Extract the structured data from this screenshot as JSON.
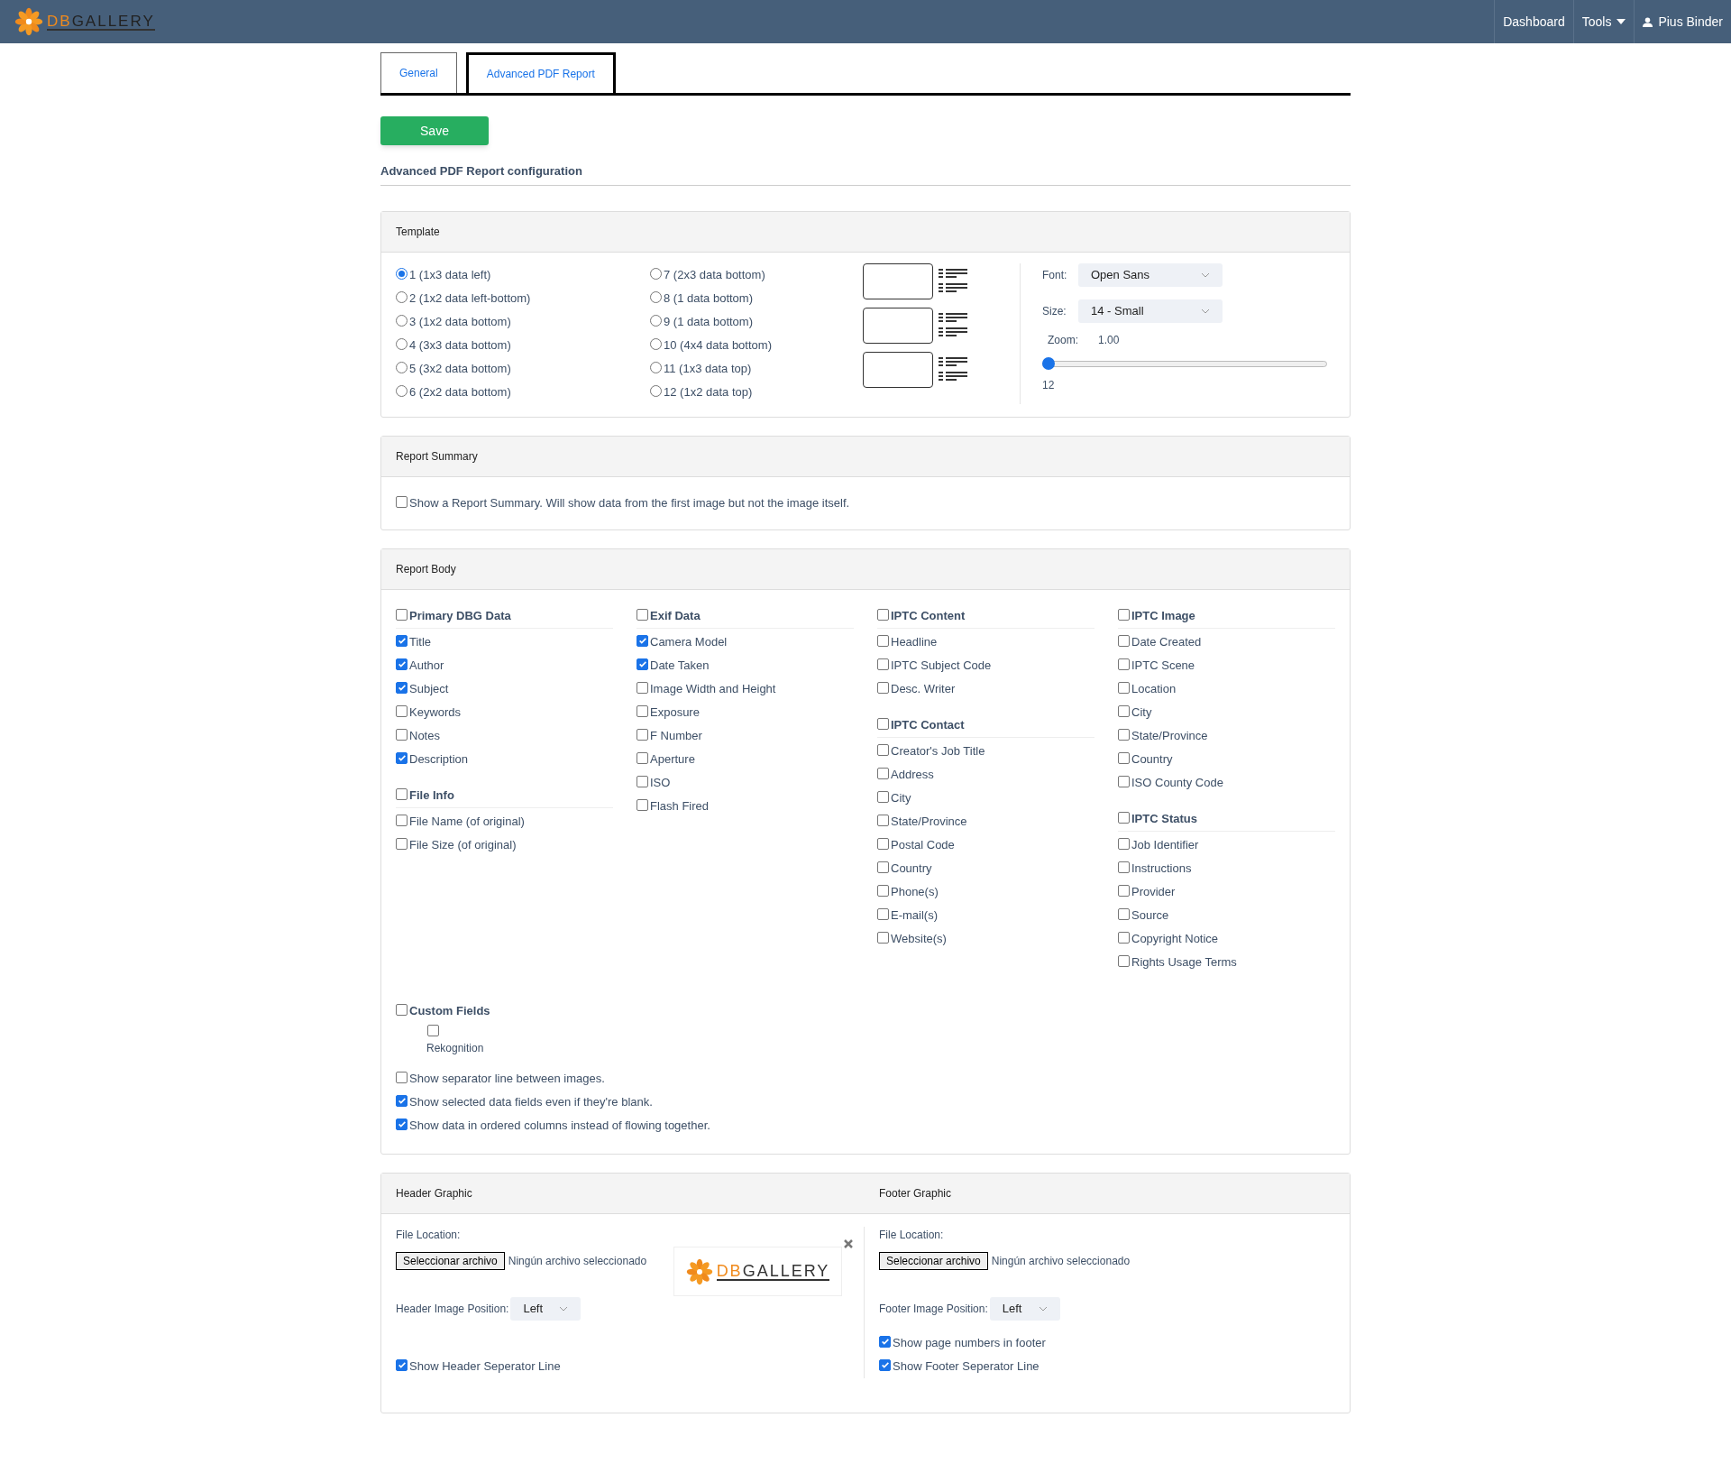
{
  "navbar": {
    "logo": {
      "part_1": "DB",
      "part_2": "GALLERY"
    },
    "links": [
      {
        "label": "Dashboard",
        "kind": "link"
      },
      {
        "label": "Tools",
        "kind": "dropdown"
      },
      {
        "label": "Pius Binder",
        "kind": "user"
      }
    ]
  },
  "tabs": [
    {
      "label": "General",
      "selected": false
    },
    {
      "label": "Advanced PDF Report",
      "selected": true
    }
  ],
  "save_button": "Save",
  "config_title": "Advanced PDF Report configuration",
  "template": {
    "title": "Template",
    "layouts": [
      {
        "label": "1 (1x3 data left)",
        "selected": true
      },
      {
        "label": "2 (1x2 data left-bottom)",
        "selected": false
      },
      {
        "label": "3 (1x2 data bottom)",
        "selected": false
      },
      {
        "label": "4 (3x3 data bottom)",
        "selected": false
      },
      {
        "label": "5 (3x2 data bottom)",
        "selected": false
      },
      {
        "label": "6 (2x2 data bottom)",
        "selected": false
      },
      {
        "label": "7 (2x3 data bottom)",
        "selected": false
      },
      {
        "label": "8 (1 data bottom)",
        "selected": false
      },
      {
        "label": "9 (1 data bottom)",
        "selected": false
      },
      {
        "label": "10 (4x4 data bottom)",
        "selected": false
      },
      {
        "label": "11 (1x3 data top)",
        "selected": false
      },
      {
        "label": "12 (1x2 data top)",
        "selected": false
      }
    ],
    "font": {
      "label": "Font:",
      "value": "Open Sans"
    },
    "size": {
      "label": "Size:",
      "value": "14 - Small"
    },
    "zoom": {
      "label": "Zoom:",
      "reading": "1.00",
      "level": 0,
      "min_label": "12"
    }
  },
  "report_summary": {
    "title": "Report Summary",
    "option": {
      "label": "Show a Report Summary. Will show data from the first image but not the image itself.",
      "checked": false
    }
  },
  "report_body": {
    "title": "Report Body",
    "columns": [
      [
        {
          "heading": "Primary DBG Data",
          "checked": false,
          "items": [
            {
              "label": "Title",
              "checked": true
            },
            {
              "label": "Author",
              "checked": true
            },
            {
              "label": "Subject",
              "checked": true
            },
            {
              "label": "Keywords",
              "checked": false
            },
            {
              "label": "Notes",
              "checked": false
            },
            {
              "label": "Description",
              "checked": true
            }
          ]
        },
        {
          "heading": "File Info",
          "checked": false,
          "items": [
            {
              "label": "File Name (of original)",
              "checked": false
            },
            {
              "label": "File Size (of original)",
              "checked": false
            }
          ]
        }
      ],
      [
        {
          "heading": "Exif Data",
          "checked": false,
          "items": [
            {
              "label": "Camera Model",
              "checked": true
            },
            {
              "label": "Date Taken",
              "checked": true
            },
            {
              "label": "Image Width and Height",
              "checked": false
            },
            {
              "label": "Exposure",
              "checked": false
            },
            {
              "label": "F Number",
              "checked": false
            },
            {
              "label": "Aperture",
              "checked": false
            },
            {
              "label": "ISO",
              "checked": false
            },
            {
              "label": "Flash Fired",
              "checked": false
            }
          ]
        }
      ],
      [
        {
          "heading": "IPTC Content",
          "checked": false,
          "items": [
            {
              "label": "Headline",
              "checked": false
            },
            {
              "label": "IPTC Subject Code",
              "checked": false
            },
            {
              "label": "Desc. Writer",
              "checked": false
            }
          ]
        },
        {
          "heading": "IPTC Contact",
          "checked": false,
          "items": [
            {
              "label": "Creator's Job Title",
              "checked": false
            },
            {
              "label": "Address",
              "checked": false
            },
            {
              "label": "City",
              "checked": false
            },
            {
              "label": "State/Province",
              "checked": false
            },
            {
              "label": "Postal Code",
              "checked": false
            },
            {
              "label": "Country",
              "checked": false
            },
            {
              "label": "Phone(s)",
              "checked": false
            },
            {
              "label": "E-mail(s)",
              "checked": false
            },
            {
              "label": "Website(s)",
              "checked": false
            }
          ]
        }
      ],
      [
        {
          "heading": "IPTC Image",
          "checked": false,
          "items": [
            {
              "label": "Date Created",
              "checked": false
            },
            {
              "label": "IPTC Scene",
              "checked": false
            },
            {
              "label": "Location",
              "checked": false
            },
            {
              "label": "City",
              "checked": false
            },
            {
              "label": "State/Province",
              "checked": false
            },
            {
              "label": "Country",
              "checked": false
            },
            {
              "label": "ISO County Code",
              "checked": false
            }
          ]
        },
        {
          "heading": "IPTC Status",
          "checked": false,
          "items": [
            {
              "label": "Job Identifier",
              "checked": false
            },
            {
              "label": "Instructions",
              "checked": false
            },
            {
              "label": "Provider",
              "checked": false
            },
            {
              "label": "Source",
              "checked": false
            },
            {
              "label": "Copyright Notice",
              "checked": false
            },
            {
              "label": "Rights Usage Terms",
              "checked": false
            }
          ]
        }
      ]
    ],
    "custom_fields": {
      "heading": "Custom Fields",
      "checked": false,
      "items": [
        {
          "label": "Rekognition",
          "checked": false
        }
      ]
    },
    "options": [
      {
        "label": "Show separator line between images.",
        "checked": false
      },
      {
        "label": "Show selected data fields even if they're blank.",
        "checked": true
      },
      {
        "label": "Show data in ordered columns instead of flowing together.",
        "checked": true
      }
    ]
  },
  "header_graphic": {
    "title": "Header Graphic",
    "file_label": "File Location:",
    "file_button": "Seleccionar archivo",
    "file_status": "Ningún archivo seleccionado",
    "preview": {
      "part_1": "DB",
      "part_2": "GALLERY"
    },
    "position_label": "Header Image Position:",
    "position": "Left",
    "options": [
      {
        "label": "Show Header Seperator Line",
        "checked": true
      }
    ]
  },
  "footer_graphic": {
    "title": "Footer Graphic",
    "file_label": "File Location:",
    "file_button": "Seleccionar archivo",
    "file_status": "Ningún archivo seleccionado",
    "position_label": "Footer Image Position:",
    "position": "Left",
    "options": [
      {
        "label": "Show page numbers in footer",
        "checked": true
      },
      {
        "label": "Show Footer Seperator Line",
        "checked": true
      }
    ]
  }
}
